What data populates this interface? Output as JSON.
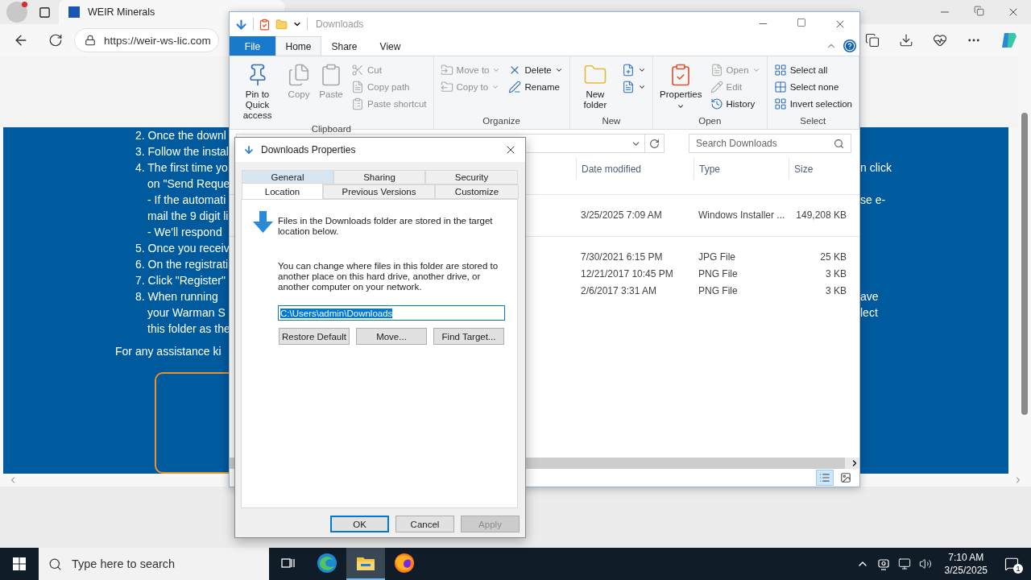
{
  "browser": {
    "tab": {
      "title": "WEIR Minerals"
    },
    "url": "https://weir-ws-lic.com",
    "page": {
      "lines": [
        {
          "kind": "numbered",
          "left": "2. Once the downl"
        },
        {
          "kind": "numbered",
          "left": "3. Follow the instal"
        },
        {
          "kind": "numbered",
          "left": "4. The first time yo",
          "right": "n click"
        },
        {
          "kind": "continued",
          "left": "on \"Send Reque"
        },
        {
          "kind": "continued",
          "left": "- If the automati",
          "right": "se e-"
        },
        {
          "kind": "continued",
          "left": "mail the 9 digit li"
        },
        {
          "kind": "continued",
          "left": "- We'll respond"
        },
        {
          "kind": "numbered",
          "left": "5. Once you receiv"
        },
        {
          "kind": "numbered",
          "left": "6. On the registrati"
        },
        {
          "kind": "numbered",
          "left": "7. Click \"Register\""
        },
        {
          "kind": "numbered",
          "left": "8. When running",
          "right": "ave"
        },
        {
          "kind": "continued",
          "left": "your Warman S",
          "right": "lect"
        },
        {
          "kind": "continued",
          "left": "this folder as the"
        }
      ],
      "assistance": "For any assistance ki"
    }
  },
  "explorer": {
    "title": "Downloads",
    "ribbon_tabs": [
      {
        "label": "File",
        "kind": "file",
        "selected": false
      },
      {
        "label": "Home",
        "kind": "tab",
        "selected": true
      },
      {
        "label": "Share",
        "kind": "tab",
        "selected": false
      },
      {
        "label": "View",
        "kind": "tab",
        "selected": false
      }
    ],
    "ribbon_groups": [
      {
        "label": "Clipboard",
        "items": [
          {
            "kind": "large",
            "label": "Pin to Quick access",
            "disabled": false,
            "menu": false
          },
          {
            "kind": "large",
            "label": "Copy",
            "disabled": true,
            "menu": false
          },
          {
            "kind": "large",
            "label": "Paste",
            "disabled": true,
            "menu": false
          },
          {
            "kind": "stack",
            "items": [
              {
                "label": "Cut",
                "disabled": true,
                "menu": false
              },
              {
                "label": "Copy path",
                "disabled": true,
                "menu": false
              },
              {
                "label": "Paste shortcut",
                "disabled": true,
                "menu": false
              }
            ]
          }
        ]
      },
      {
        "label": "Organize",
        "items": [
          {
            "kind": "stack",
            "items": [
              {
                "label": "Move to",
                "disabled": true,
                "menu": true
              },
              {
                "label": "Copy to",
                "disabled": true,
                "menu": true
              }
            ]
          },
          {
            "kind": "stack",
            "items": [
              {
                "label": "Delete",
                "disabled": false,
                "menu": true
              },
              {
                "label": "Rename",
                "disabled": false,
                "menu": false
              }
            ]
          }
        ]
      },
      {
        "label": "New",
        "items": [
          {
            "kind": "large",
            "label": "New folder",
            "disabled": false,
            "menu": false
          },
          {
            "kind": "stack",
            "items": [
              {
                "disabled": false,
                "menu": true
              },
              {
                "disabled": false,
                "menu": true
              }
            ]
          }
        ]
      },
      {
        "label": "Open",
        "items": [
          {
            "kind": "large",
            "label": "Properties",
            "disabled": false,
            "menu": true
          },
          {
            "kind": "stack",
            "items": [
              {
                "label": "Open",
                "disabled": true,
                "menu": true
              },
              {
                "label": "Edit",
                "disabled": true,
                "menu": false
              },
              {
                "label": "History",
                "disabled": false,
                "menu": false
              }
            ]
          }
        ]
      },
      {
        "label": "Select",
        "items": [
          {
            "kind": "stack",
            "items": [
              {
                "label": "Select all",
                "disabled": false,
                "menu": false
              },
              {
                "label": "Select none",
                "disabled": false,
                "menu": false
              },
              {
                "label": "Invert selection",
                "disabled": false,
                "menu": false
              }
            ]
          }
        ]
      }
    ],
    "search": {
      "placeholder": "Search Downloads"
    },
    "columns": [
      "Date modified",
      "Type",
      "Size"
    ],
    "file_groups": [
      {
        "rows": [
          [
            "3/25/2025 7:09 AM",
            "Windows Installer ...",
            "149,208 KB"
          ]
        ]
      },
      {
        "rows": [
          [
            "7/30/2021 6:15 PM",
            "JPG File",
            "25 KB"
          ],
          [
            "12/21/2017 10:45 PM",
            "PNG File",
            "3 KB"
          ],
          [
            "2/6/2017 3:31 AM",
            "PNG File",
            "3 KB"
          ]
        ]
      }
    ],
    "view_buttons": [
      {
        "selected": true
      },
      {
        "selected": false
      }
    ]
  },
  "dialog": {
    "title": "Downloads Properties",
    "tab_rows": [
      {
        "tabs": [
          {
            "label": "General",
            "selected": false,
            "highlighted": true
          },
          {
            "label": "Sharing",
            "selected": false,
            "highlighted": false
          },
          {
            "label": "Security",
            "selected": false,
            "highlighted": false
          }
        ]
      },
      {
        "tabs": [
          {
            "label": "Location",
            "selected": true,
            "highlighted": false
          },
          {
            "label": "Previous Versions",
            "selected": false,
            "highlighted": false
          },
          {
            "label": "Customize",
            "selected": false,
            "highlighted": false
          }
        ]
      }
    ],
    "info": "Files in the Downloads folder are stored in the target location below.",
    "description": "You can change where files in this folder are stored to another place on this hard drive, another drive, or another computer on your network.",
    "path": {
      "value": "C:\\Users\\admin\\Downloads",
      "text_selected": true
    },
    "actions": [
      "Restore Default",
      "Move...",
      "Find Target..."
    ],
    "buttons": [
      {
        "label": "OK",
        "default": true,
        "disabled": false
      },
      {
        "label": "Cancel",
        "default": false,
        "disabled": false
      },
      {
        "label": "Apply",
        "default": false,
        "disabled": true
      }
    ]
  },
  "taskbar": {
    "search": {
      "placeholder": "Type here to search"
    },
    "apps": [
      {
        "selected": false
      },
      {
        "selected": false
      },
      {
        "selected": true
      },
      {
        "selected": false
      }
    ],
    "time": "7:10 AM",
    "date": "3/25/2025",
    "notifications": "1"
  }
}
